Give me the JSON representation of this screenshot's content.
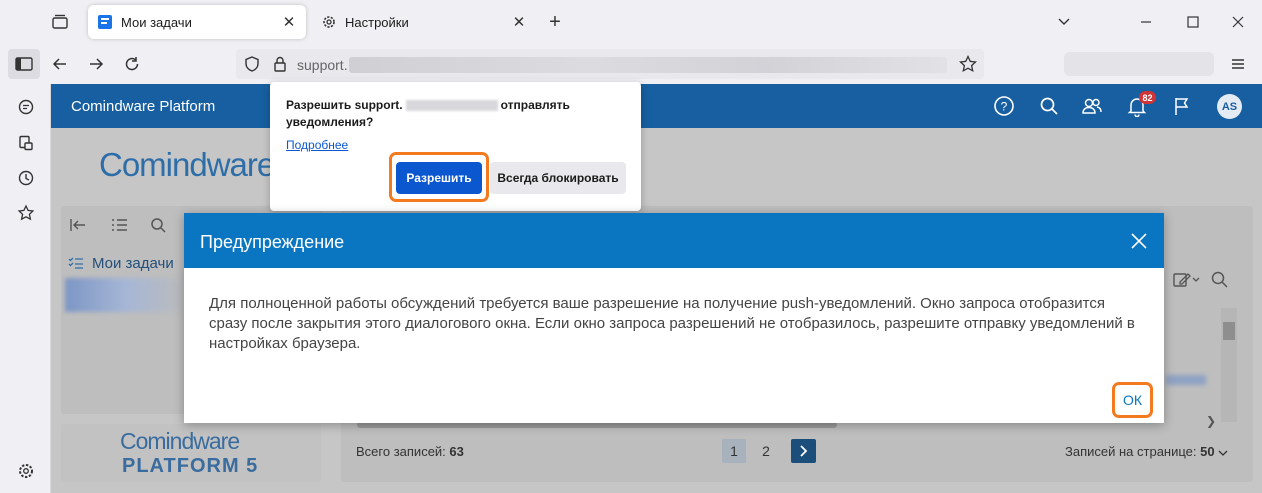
{
  "browser": {
    "tabs": [
      {
        "label": "Мои задачи",
        "active": true
      },
      {
        "label": "Настройки",
        "active": false
      }
    ],
    "url_prefix": "support."
  },
  "app": {
    "title": "Comindware Platform",
    "notifications_count": "82",
    "avatar_initials": "AS",
    "brand_color": "#175fa0"
  },
  "page": {
    "logo_text": "Comindware",
    "logo_bottom_line1": "Comindware",
    "logo_bottom_line2": "PLATFORM 5",
    "my_tasks_label": "Мои задачи",
    "total_label": "Всего записей: ",
    "total_count": "63",
    "pages": [
      "1",
      "2"
    ],
    "per_page_label": "Записей на странице: ",
    "per_page_value": "50"
  },
  "permission_popup": {
    "question_part1": "Разрешить support.",
    "question_part2": "отправлять уведомления?",
    "more_link": "Подробнее",
    "allow_button": "Разрешить",
    "block_button": "Всегда блокировать"
  },
  "dialog": {
    "title": "Предупреждение",
    "message": "Для полноценной работы обсуждений требуется ваше разрешение на получение push-уведомлений. Окно запроса отобразится сразу после закрытия этого диалогового окна. Если окно запроса разрешений не отобразилось, разрешите отправку уведомлений в настройках браузера.",
    "ok_button": "ОК",
    "header_color": "#0a76c1",
    "highlight_color": "#f47a20"
  }
}
